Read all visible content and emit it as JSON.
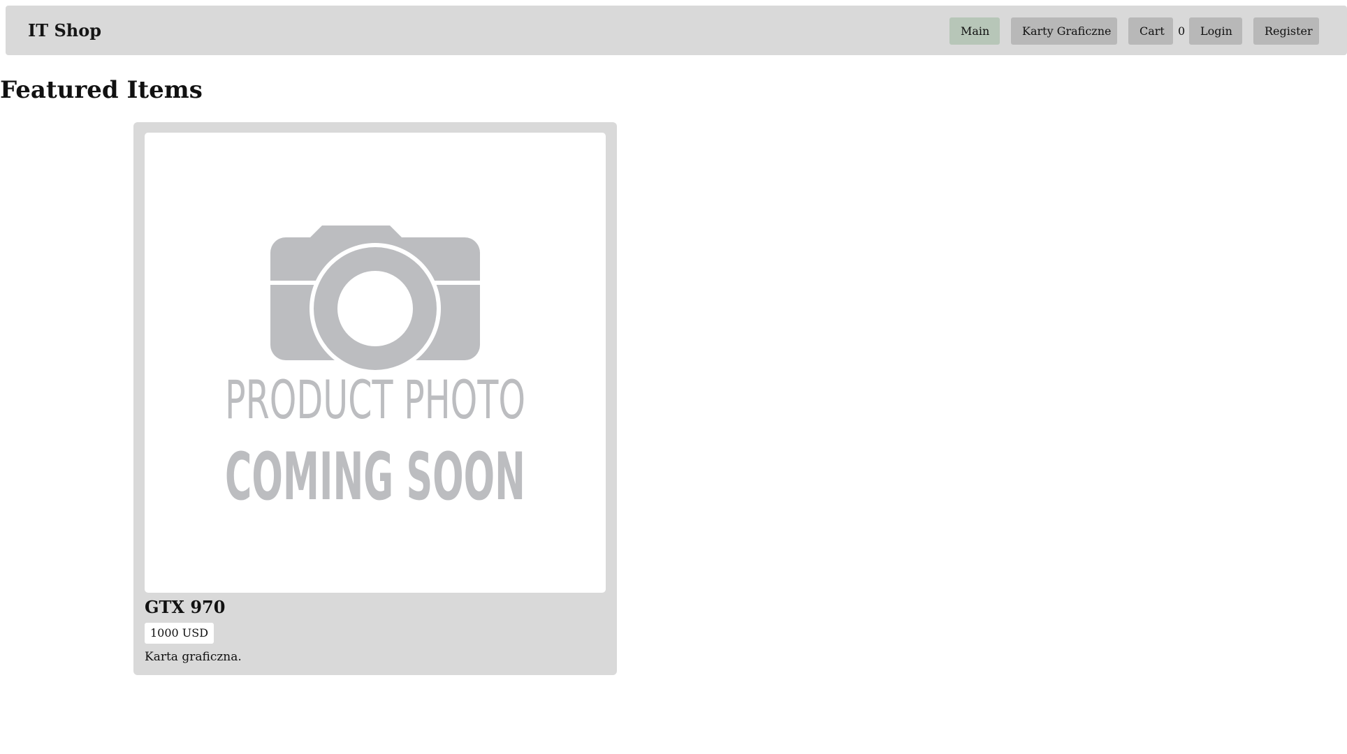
{
  "navbar": {
    "brand": "IT Shop",
    "items": [
      {
        "label": "Main"
      },
      {
        "label": "Karty Graficzne"
      },
      {
        "label": "Cart"
      },
      {
        "label": "Login"
      },
      {
        "label": "Register"
      }
    ],
    "cart_count": "0"
  },
  "page": {
    "title": "Featured Items"
  },
  "products": [
    {
      "image_text_line1": "PRODUCT PHOTO",
      "image_text_line2": "COMING SOON",
      "name": "GTX 970",
      "price": "1000 USD",
      "description": "Karta graficzna."
    }
  ],
  "colors": {
    "navbar_bg": "#d9d9d9",
    "nav_button_bg": "#b8b8b8",
    "nav_button_active_bg": "#b7c6b8",
    "card_bg": "#d9d9d9",
    "placeholder_gray": "#bcbdc0"
  },
  "icons": {
    "image_placeholder": "camera-icon"
  }
}
